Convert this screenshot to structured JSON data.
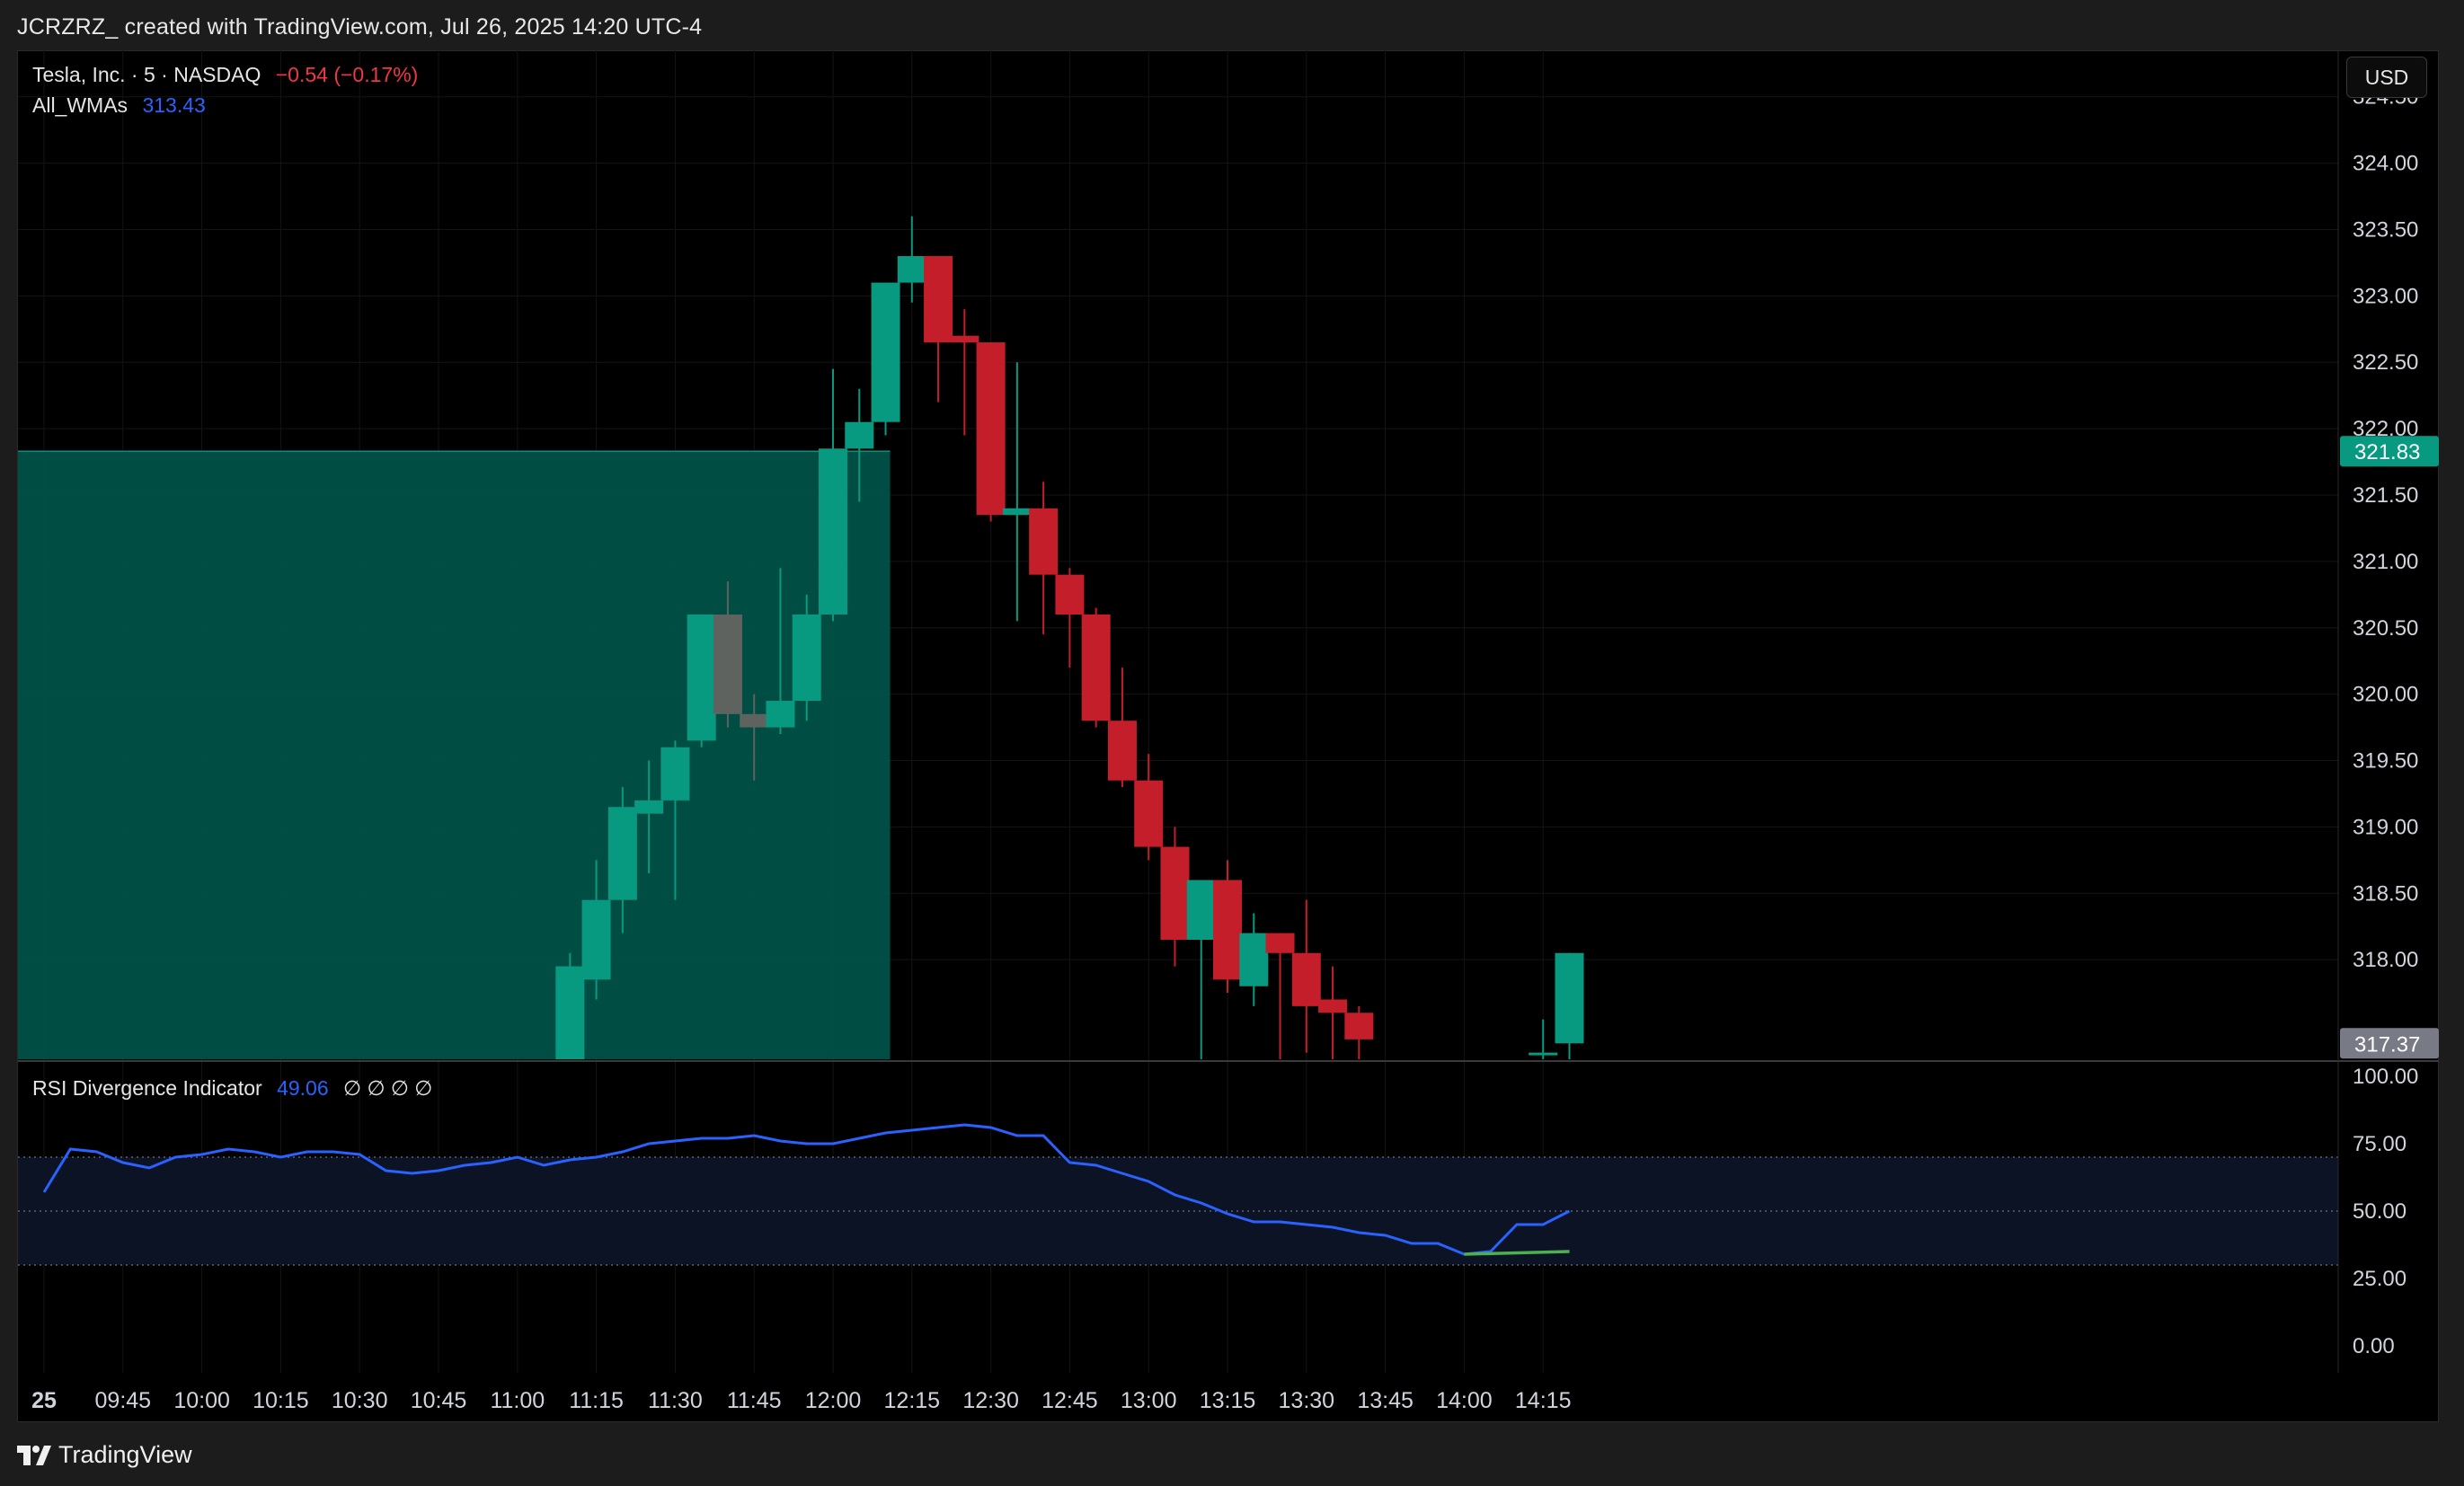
{
  "header": {
    "caption": "JCRZRZ_ created with TradingView.com, Jul 26, 2025 14:20 UTC-4"
  },
  "footer": {
    "brand": "TradingView"
  },
  "main_legend": {
    "symbol": "Tesla, Inc. · 5 · NASDAQ",
    "change": "−0.54 (−0.17%)",
    "change_color": "#f23645",
    "indicator_name": "All_WMAs",
    "indicator_value": "313.43",
    "indicator_color": "#2962ff"
  },
  "rsi_legend": {
    "name": "RSI Divergence Indicator",
    "value": "49.06",
    "symbols": "∅ ∅ ∅ ∅"
  },
  "currency_button": "USD",
  "colors": {
    "up": "#089981",
    "down": "#c41e2a",
    "neutral": "#5f6360",
    "zone": "#005247",
    "rsi_line": "#2962ff",
    "rsi_div": "#4caf50"
  },
  "chart_data": [
    {
      "type": "candlestick",
      "title": "Tesla, Inc. · 5 · NASDAQ",
      "ylim": [
        317.25,
        324.85
      ],
      "y_ticks": [
        "324.50",
        "324.00",
        "323.50",
        "323.00",
        "322.50",
        "322.00",
        "321.50",
        "321.00",
        "320.50",
        "320.00",
        "319.50",
        "319.00",
        "318.50",
        "318.00"
      ],
      "price_labels": [
        {
          "text": "321.83",
          "value": 321.83,
          "color": "#089981"
        },
        {
          "text": "317.37",
          "value": 317.37,
          "color": "#787b86"
        }
      ],
      "highlight_zone": {
        "x_from": "09:30",
        "x_to": "12:10",
        "y_from": 317.25,
        "y_to": 321.83
      },
      "x_ticks": [
        "25",
        "09:45",
        "10:00",
        "10:15",
        "10:30",
        "10:45",
        "11:00",
        "11:15",
        "11:30",
        "11:45",
        "12:00",
        "12:15",
        "12:30",
        "12:45",
        "13:00",
        "13:15",
        "13:30",
        "13:45",
        "14:00",
        "14:15"
      ],
      "candles": [
        {
          "t": "11:10",
          "o": 317.2,
          "h": 318.05,
          "l": 317.1,
          "c": 317.95
        },
        {
          "t": "11:15",
          "o": 317.85,
          "h": 318.75,
          "l": 317.7,
          "c": 318.45
        },
        {
          "t": "11:20",
          "o": 318.45,
          "h": 319.3,
          "l": 318.2,
          "c": 319.15
        },
        {
          "t": "11:25",
          "o": 319.1,
          "h": 319.5,
          "l": 318.65,
          "c": 319.2
        },
        {
          "t": "11:30",
          "o": 319.2,
          "h": 319.65,
          "l": 318.45,
          "c": 319.6
        },
        {
          "t": "11:35",
          "o": 319.65,
          "h": 320.6,
          "l": 319.6,
          "c": 320.6
        },
        {
          "t": "11:40",
          "o": 320.6,
          "h": 320.85,
          "l": 319.75,
          "c": 319.85
        },
        {
          "t": "11:45",
          "o": 319.85,
          "h": 320.0,
          "l": 319.35,
          "c": 319.75
        },
        {
          "t": "11:50",
          "o": 319.75,
          "h": 320.95,
          "l": 319.7,
          "c": 319.95
        },
        {
          "t": "11:55",
          "o": 319.95,
          "h": 320.75,
          "l": 319.8,
          "c": 320.6
        },
        {
          "t": "12:00",
          "o": 320.6,
          "h": 322.45,
          "l": 320.55,
          "c": 321.85
        },
        {
          "t": "12:05",
          "o": 321.85,
          "h": 322.3,
          "l": 321.45,
          "c": 322.05
        },
        {
          "t": "12:10",
          "o": 322.05,
          "h": 323.1,
          "l": 321.95,
          "c": 323.1
        },
        {
          "t": "12:15",
          "o": 323.1,
          "h": 323.6,
          "l": 322.95,
          "c": 323.3
        },
        {
          "t": "12:20",
          "o": 323.3,
          "h": 323.3,
          "l": 322.2,
          "c": 322.65
        },
        {
          "t": "12:25",
          "o": 322.7,
          "h": 322.9,
          "l": 321.95,
          "c": 322.65
        },
        {
          "t": "12:30",
          "o": 322.65,
          "h": 322.65,
          "l": 321.3,
          "c": 321.35
        },
        {
          "t": "12:35",
          "o": 321.35,
          "h": 322.5,
          "l": 320.55,
          "c": 321.4
        },
        {
          "t": "12:40",
          "o": 321.4,
          "h": 321.6,
          "l": 320.45,
          "c": 320.9
        },
        {
          "t": "12:45",
          "o": 320.9,
          "h": 320.95,
          "l": 320.2,
          "c": 320.6
        },
        {
          "t": "12:50",
          "o": 320.6,
          "h": 320.65,
          "l": 319.75,
          "c": 319.8
        },
        {
          "t": "12:55",
          "o": 319.8,
          "h": 320.2,
          "l": 319.3,
          "c": 319.35
        },
        {
          "t": "13:00",
          "o": 319.35,
          "h": 319.55,
          "l": 318.75,
          "c": 318.85
        },
        {
          "t": "13:05",
          "o": 318.85,
          "h": 319.0,
          "l": 317.95,
          "c": 318.15
        },
        {
          "t": "13:10",
          "o": 318.15,
          "h": 318.6,
          "l": 317.2,
          "c": 318.6
        },
        {
          "t": "13:15",
          "o": 318.6,
          "h": 318.75,
          "l": 317.75,
          "c": 317.85
        },
        {
          "t": "13:20",
          "o": 317.8,
          "h": 318.35,
          "l": 317.65,
          "c": 318.2
        },
        {
          "t": "13:25",
          "o": 318.2,
          "h": 318.2,
          "l": 317.25,
          "c": 318.05
        },
        {
          "t": "13:30",
          "o": 318.05,
          "h": 318.45,
          "l": 317.3,
          "c": 317.65
        },
        {
          "t": "13:35",
          "o": 317.7,
          "h": 317.95,
          "l": 317.25,
          "c": 317.6
        },
        {
          "t": "13:40",
          "o": 317.6,
          "h": 317.65,
          "l": 317.25,
          "c": 317.4
        },
        {
          "t": "14:15",
          "o": 317.3,
          "h": 317.55,
          "l": 317.25,
          "c": 317.3
        },
        {
          "t": "14:20",
          "o": 317.37,
          "h": 318.05,
          "l": 317.25,
          "c": 318.05
        }
      ]
    },
    {
      "type": "line",
      "title": "RSI Divergence Indicator",
      "ylim": [
        -10,
        105
      ],
      "y_ticks": [
        "100.00",
        "75.00",
        "50.00",
        "25.00",
        "0.00"
      ],
      "bands": {
        "upper": 70,
        "middle": 50,
        "lower": 30
      },
      "series": [
        {
          "color": "#2962ff",
          "x": [
            "09:30",
            "09:35",
            "09:40",
            "09:45",
            "09:50",
            "09:55",
            "10:00",
            "10:05",
            "10:10",
            "10:15",
            "10:20",
            "10:25",
            "10:30",
            "10:35",
            "10:40",
            "10:45",
            "10:50",
            "10:55",
            "11:00",
            "11:05",
            "11:10",
            "11:15",
            "11:20",
            "11:25",
            "11:30",
            "11:35",
            "11:40",
            "11:45",
            "11:50",
            "11:55",
            "12:00",
            "12:05",
            "12:10",
            "12:15",
            "12:20",
            "12:25",
            "12:30",
            "12:35",
            "12:40",
            "12:45",
            "12:50",
            "12:55",
            "13:00",
            "13:05",
            "13:10",
            "13:15",
            "13:20",
            "13:25",
            "13:30",
            "13:35",
            "13:40",
            "13:45",
            "13:50",
            "13:55",
            "14:00",
            "14:05",
            "14:10",
            "14:15",
            "14:20"
          ],
          "values": [
            57,
            73,
            72,
            68,
            66,
            70,
            71,
            73,
            72,
            70,
            72,
            72,
            71,
            65,
            64,
            65,
            67,
            68,
            70,
            67,
            69,
            70,
            72,
            75,
            76,
            77,
            77,
            78,
            76,
            75,
            75,
            77,
            79,
            80,
            81,
            82,
            81,
            78,
            78,
            68,
            67,
            64,
            61,
            56,
            53,
            49,
            46,
            46,
            45,
            44,
            42,
            41,
            38,
            38,
            34,
            35,
            45,
            45,
            50
          ]
        },
        {
          "color": "#4caf50",
          "x": [
            "14:00",
            "14:20"
          ],
          "values": [
            34,
            35
          ]
        }
      ]
    }
  ]
}
